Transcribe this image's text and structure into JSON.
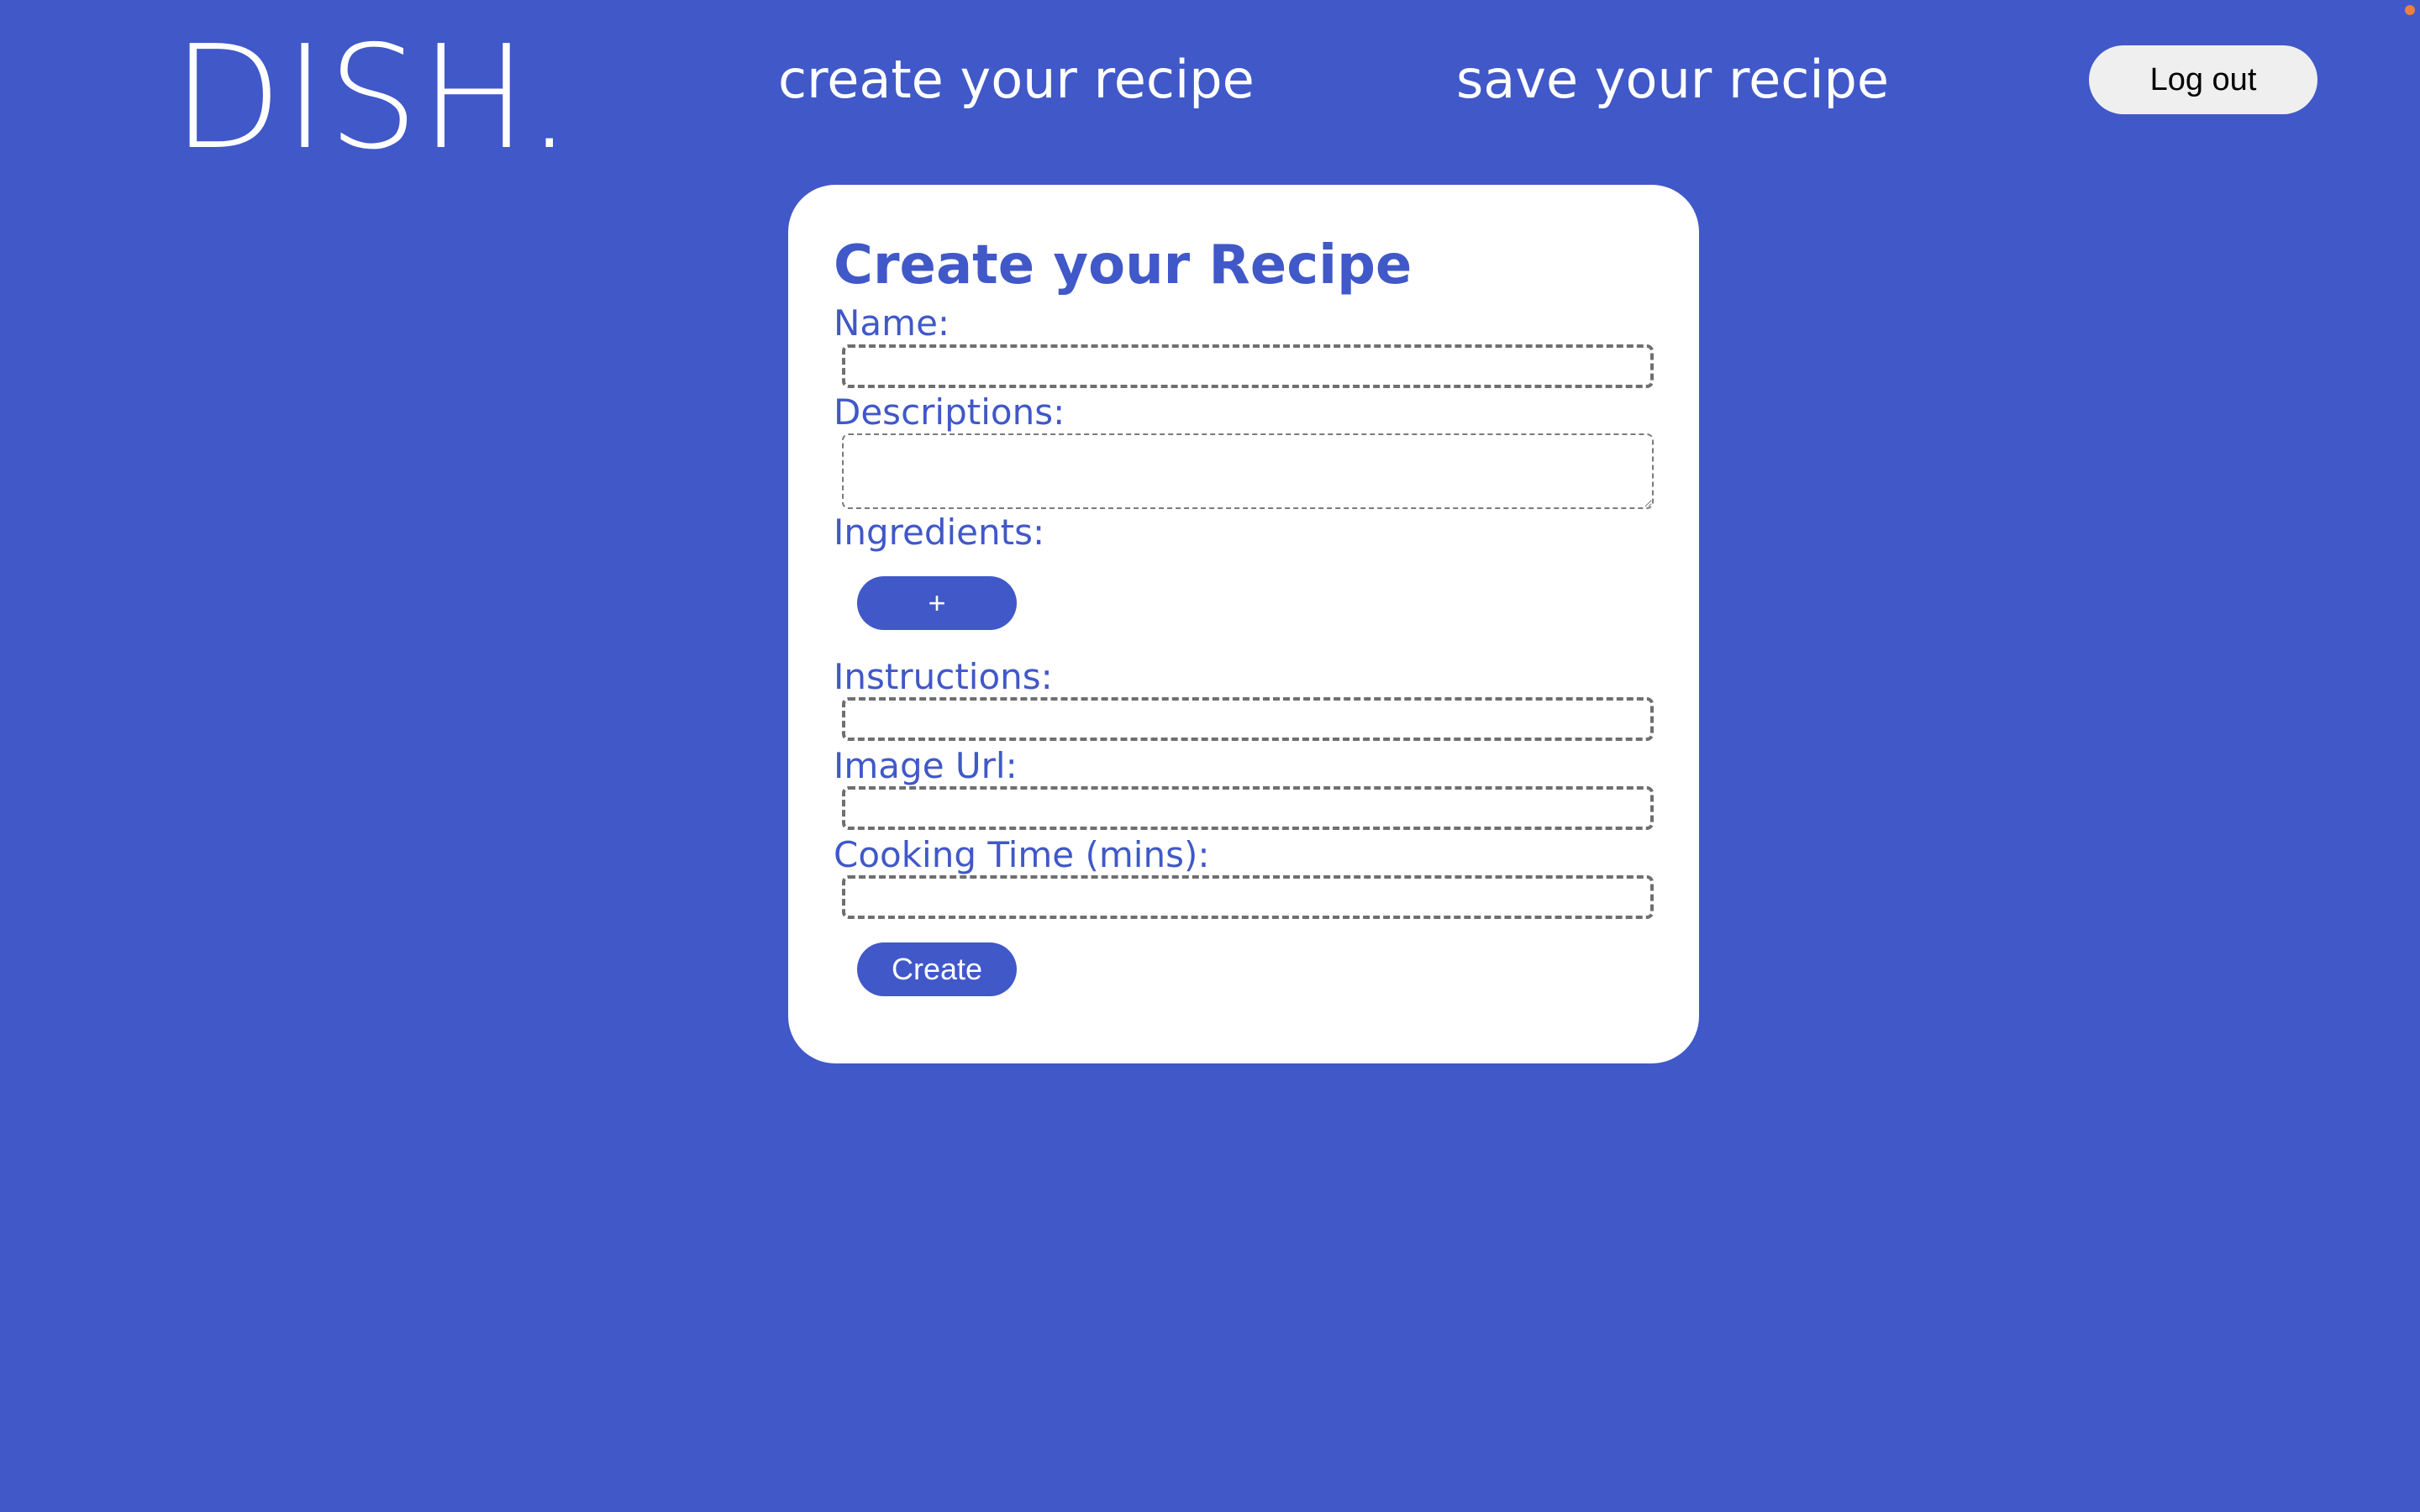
{
  "header": {
    "logo_text": "DISH.",
    "nav": {
      "create_label": "create your recipe",
      "save_label": "save your recipe"
    },
    "logout_label": "Log out"
  },
  "form": {
    "title": "Create your Recipe",
    "fields": {
      "name": {
        "label": "Name:",
        "value": "",
        "placeholder": ""
      },
      "description": {
        "label": "Descriptions:",
        "value": "",
        "placeholder": ""
      },
      "ingredients": {
        "label": "Ingredients:",
        "add_button_label": "+"
      },
      "instructions": {
        "label": "Instructions:",
        "value": "",
        "placeholder": ""
      },
      "image_url": {
        "label": "Image Url:",
        "value": "",
        "placeholder": ""
      },
      "cooking_time": {
        "label": "Cooking Time (mins):",
        "value": "",
        "placeholder": ""
      }
    },
    "submit_label": "Create"
  },
  "colors": {
    "background": "#4058c8",
    "card": "#ffffff",
    "accent": "#4058c8",
    "logout_button": "#efefef",
    "input_border": "#6f6f6f",
    "corner_dot": "#e8823d"
  }
}
